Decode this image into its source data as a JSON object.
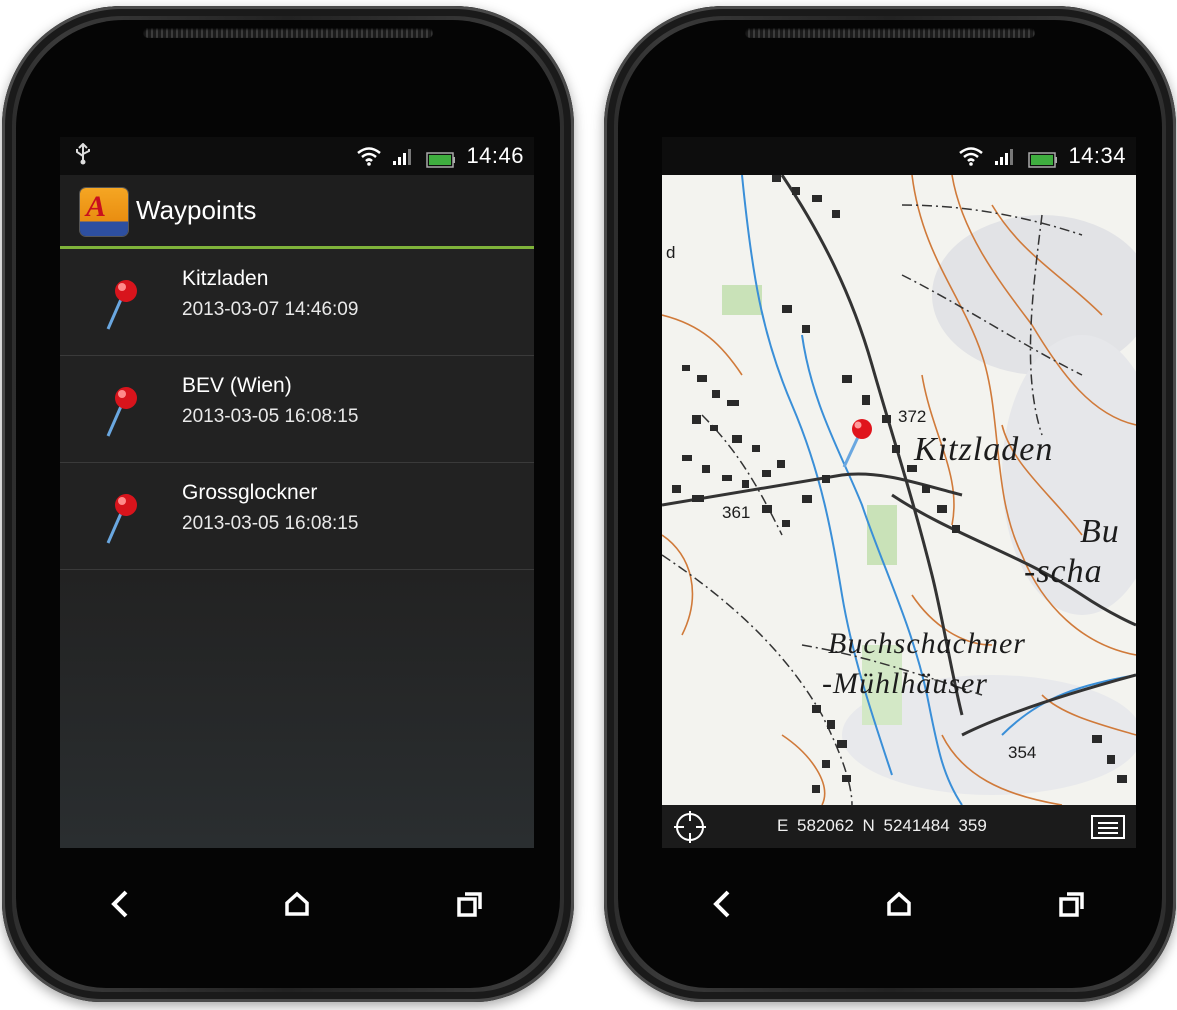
{
  "left_phone": {
    "status": {
      "time": "14:46",
      "usb_icon": "usb-icon"
    },
    "appbar": {
      "logo_letter": "A",
      "title": "Waypoints"
    },
    "waypoints": [
      {
        "name": "Kitzladen",
        "date": "2013-03-07 14:46:09"
      },
      {
        "name": "BEV (Wien)",
        "date": "2013-03-05 16:08:15"
      },
      {
        "name": "Grossglockner",
        "date": "2013-03-05 16:08:15"
      }
    ]
  },
  "right_phone": {
    "status": {
      "time": "14:34"
    },
    "map": {
      "labels": {
        "kitzladen": "Kitzladen",
        "buchschachner": "Buchschachner",
        "muehlhaeuser": "-Mühlhäuser",
        "bu": "Bu",
        "scha": "-scha",
        "alt_372": "372",
        "alt_361": "361",
        "alt_354": "354",
        "fragment_d": "d"
      }
    },
    "bottombar": {
      "coordinates": "E 582062  N 5241484  359"
    }
  },
  "colors": {
    "accent_line": "#7fb33a",
    "pin_red": "#e0141c",
    "contour": "#d07a3a",
    "river": "#3a8fd8",
    "forest": "#c9e2b8"
  }
}
